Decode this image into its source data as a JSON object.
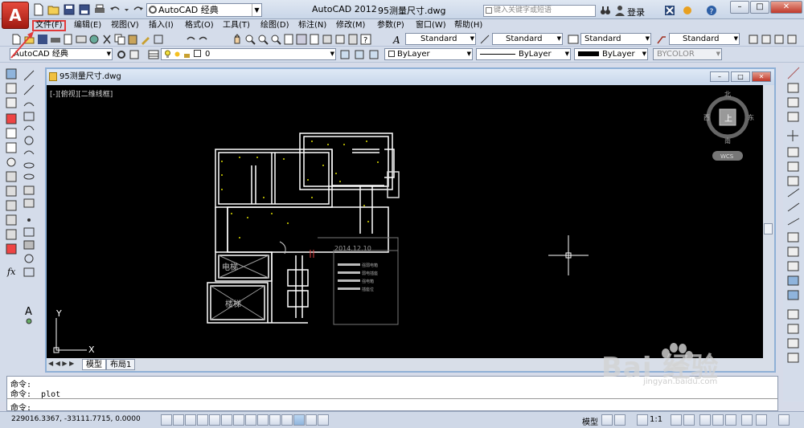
{
  "app": {
    "logo_letter": "A",
    "title": "AutoCAD 2012",
    "file_title": "95测量尺寸.dwg",
    "workspace": "AutoCAD 经典",
    "search_placeholder": "键入关键字或短语",
    "login_label": "登录"
  },
  "menu": {
    "items": [
      "文件(F)",
      "编辑(E)",
      "视图(V)",
      "插入(I)",
      "格式(O)",
      "工具(T)",
      "绘图(D)",
      "标注(N)",
      "修改(M)",
      "参数(P)",
      "窗口(W)",
      "帮助(H)"
    ],
    "highlighted": "文件(F)"
  },
  "toolbar": {
    "text_style": "Standard",
    "dim_style": "Standard",
    "table_style": "Standard",
    "mleader_style": "Standard",
    "workspace2": "AutoCAD 经典",
    "layer": "0",
    "color": "ByLayer",
    "linetype": "ByLayer",
    "lineweight": "ByLayer",
    "plotstyle": "BYCOLOR"
  },
  "drawing": {
    "window_title": "95测量尺寸.dwg",
    "view_label": "[-][俯视][二维线框]",
    "compass": {
      "north": "北",
      "south": "南",
      "east": "东",
      "west": "西",
      "center": "上",
      "wcs": "WCS"
    },
    "date_text": "2014.12.10",
    "room_labels": [
      "电梯",
      "楼梯"
    ],
    "legend": [
      "强弱电箱",
      "弱电插座",
      "强电箱",
      "插座位"
    ],
    "ucs_y": "Y",
    "ucs_x": "X",
    "tabs": [
      "模型",
      "布局1"
    ]
  },
  "command": {
    "line1": "命令:",
    "line2": "命令: _plot",
    "prompt": "命令:"
  },
  "status": {
    "coordinates": "229016.3367, -33111.7715, 0.0000",
    "model": "模型",
    "scale": "1:1"
  },
  "watermark": {
    "logo": "Bai  经验",
    "url": "jingyan.baidu.com"
  },
  "colors": {
    "accent": "#e23a3a",
    "cad_bg": "#000000",
    "wall": "#ffffff",
    "dim_dots": "#d8d800"
  }
}
